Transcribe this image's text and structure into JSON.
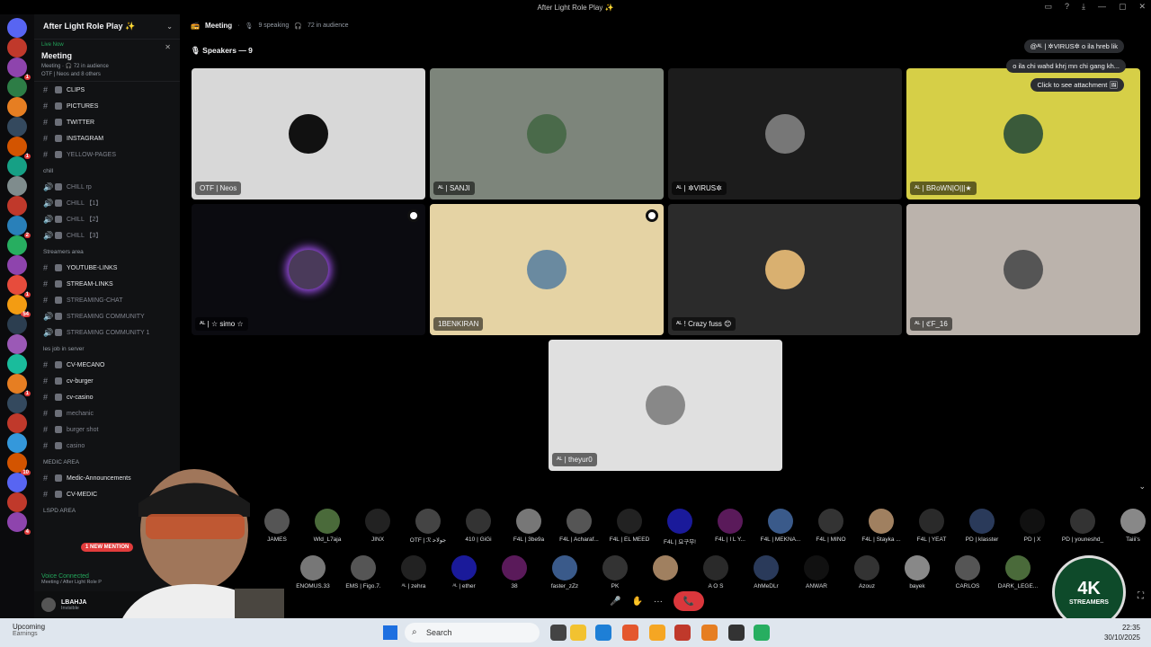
{
  "window": {
    "title": "After Light Role Play ✨"
  },
  "guild": {
    "name": "After Light Role Play ✨"
  },
  "live_card": {
    "status": "Live Now",
    "title": "Meeting",
    "sub1": "Meeting · 🎧 72 in audience",
    "sub2": "OTF | Neos and 8 others"
  },
  "channels": [
    {
      "type": "text",
      "label": "CLIPS"
    },
    {
      "type": "text",
      "label": "PICTURES"
    },
    {
      "type": "text",
      "label": "TWITTER"
    },
    {
      "type": "text",
      "label": "INSTAGRAM"
    },
    {
      "type": "text",
      "label": "YELLOW-PAGES",
      "muted": true
    },
    {
      "type": "cat",
      "label": "chill"
    },
    {
      "type": "voice",
      "label": "CHILL rp",
      "muted": true
    },
    {
      "type": "voice",
      "label": "CHILL 【1】",
      "muted": true
    },
    {
      "type": "voice",
      "label": "CHILL 【2】",
      "muted": true
    },
    {
      "type": "voice",
      "label": "CHILL 【3】",
      "muted": true
    },
    {
      "type": "cat",
      "label": "Streamers area"
    },
    {
      "type": "text",
      "label": "YOUTUBE-LINKS"
    },
    {
      "type": "text",
      "label": "STREAM-LINKS"
    },
    {
      "type": "text",
      "label": "STREAMING-CHAT",
      "muted": true
    },
    {
      "type": "voice",
      "label": "STREAMING COMMUNITY",
      "muted": true
    },
    {
      "type": "voice",
      "label": "STREAMING COMMUNITY 1",
      "muted": true
    },
    {
      "type": "cat",
      "label": "les job in server"
    },
    {
      "type": "text",
      "label": "CV-MECANO"
    },
    {
      "type": "text",
      "label": "cv-burger"
    },
    {
      "type": "text",
      "label": "cv-casino"
    },
    {
      "type": "text",
      "label": "mechanic",
      "muted": true
    },
    {
      "type": "text",
      "label": "burger shot",
      "muted": true
    },
    {
      "type": "text",
      "label": "casino",
      "muted": true
    },
    {
      "type": "cat",
      "label": "MEDIC AREA"
    },
    {
      "type": "text",
      "label": "Medic-Announcements"
    },
    {
      "type": "text",
      "label": "CV-MEDIC"
    },
    {
      "type": "cat",
      "label": "LSPD AREA"
    }
  ],
  "new_mention": "1 NEW MENTION",
  "voice_connected": {
    "title": "Voice Connected",
    "sub": "Meeting / After Light Role P"
  },
  "user": {
    "name": "LBAHJA",
    "status": "Invisible"
  },
  "stage": {
    "title": "Meeting",
    "speaking": "9 speaking",
    "audience": "72 in audience",
    "speakers_label": "Speakers — 9"
  },
  "notifications": [
    "@ᴬᴸ | ✲VIRUS✲ o ila hreb lik",
    "o ila chi wahd khrj mn chi gang kh...",
    "Click to see attachment 🖼"
  ],
  "tiles": [
    {
      "name": "OTF | Neos",
      "bg": "#d8d8d8",
      "avatar": "#111"
    },
    {
      "name": "ᴬᴸ | SANJI",
      "bg": "#7d857b",
      "avatar": "#4a6a4a"
    },
    {
      "name": "ᴬᴸ | ✲VIRUS✲",
      "bg": "#1c1c1c",
      "avatar": "#777"
    },
    {
      "name": "ᴬᴸ | BRoWN|O|||★",
      "bg": "#d6cf47",
      "avatar": "#3a5a3a"
    },
    {
      "name": "ᴬᴸ | ☆ simo ☆",
      "bg": "#0b0b10",
      "avatar": "#4a3a5a"
    },
    {
      "name": "1BENKIRAN",
      "bg": "#e5d3a4",
      "avatar": "#6a8aa0"
    },
    {
      "name": "ᴬᴸ ! Crazy fuss 😊",
      "bg": "#2b2b2b",
      "avatar": "#d9b070"
    },
    {
      "name": "ᴬᴸ | ℭF_16",
      "bg": "#bbb3ac",
      "avatar": "#555"
    },
    {
      "name": "ᴬᴸ | theyur0",
      "bg": "#e0e0e0",
      "avatar": "#888"
    }
  ],
  "audience_row1": [
    "JAMES",
    "Wld_L7aja",
    "JINX",
    "OTF | ℛ ﺟﻮﻟﺎﺣ",
    "410 | GiGi",
    "F4L | 3be9a",
    "F4L | Acharaf...",
    "F4L | EL MEED",
    "F4L | 요구무!",
    "F4L | I L Y...",
    "F4L | MEKNA...",
    "F4L | MINO",
    "F4L | Stayka ...",
    "F4L | YEAT",
    "PD | klasster",
    "PD | X",
    "PD | youneshd_",
    "Taiii's"
  ],
  "audience_row2": [
    "ENOMUS.33",
    "EMS | Figo.7.",
    "ᴬᴸ | zehra",
    "ᴬᴸ | ether",
    "38",
    "faster_zZz",
    "PK",
    "",
    "A O S",
    "AhMeDLr",
    "ANWAR",
    "Azouz",
    "bayek",
    "CARLOS",
    "DARK_LEGE..."
  ],
  "taskbar": {
    "weather_title": "Upcoming",
    "weather_sub": "Earnings",
    "search": "Search",
    "time": "22:35",
    "date": "30/10/2025"
  },
  "logo": {
    "text1": "4K",
    "text2": "STREAMERS"
  },
  "colors": {
    "accent": "#5865f2",
    "danger": "#da373c",
    "online": "#23a55a"
  }
}
